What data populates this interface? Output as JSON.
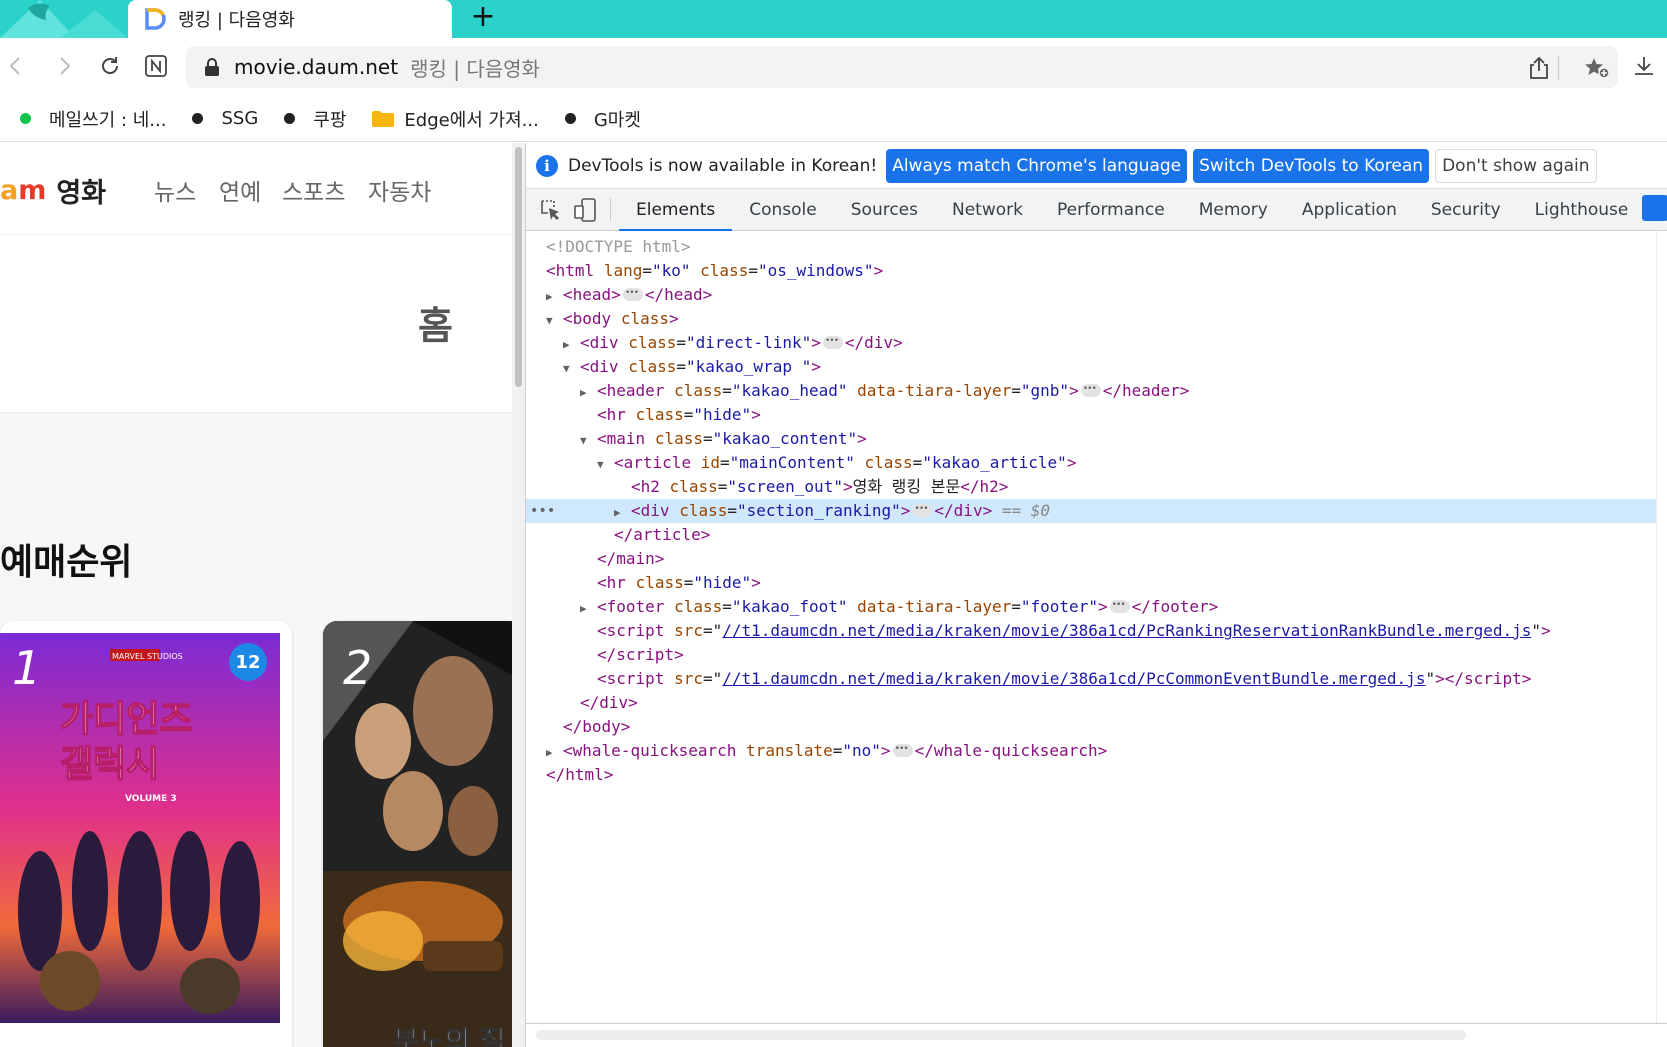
{
  "browser": {
    "tab_title": "랭킹 | 다음영화",
    "new_tab_label": "+",
    "url_host": "movie.daum.net",
    "url_page_title": "랭킹 | 다음영화",
    "accent_color": "#2ad2c9"
  },
  "bookmarks": [
    {
      "label": "메일쓰기 : 네...",
      "type": "dot-green"
    },
    {
      "label": "SSG",
      "type": "dot"
    },
    {
      "label": "쿠팡",
      "type": "dot"
    },
    {
      "label": "Edge에서 가져...",
      "type": "folder"
    },
    {
      "label": "G마켓",
      "type": "dot"
    }
  ],
  "page": {
    "logo_daum_prefix": "a",
    "logo_daum_suffix": "m",
    "logo_text": "영화",
    "gnb": [
      "뉴스",
      "연예",
      "스포츠",
      "자동차"
    ],
    "home_label": "홈",
    "rank_title": "예매순위",
    "posters": [
      {
        "rank": "1",
        "age": "12",
        "title_art": "가디언즈 오브 갤럭시",
        "subtitle": "VOLUME 3"
      },
      {
        "rank": "2",
        "title_art": "분노의 질주"
      }
    ]
  },
  "devtools": {
    "info_text": "DevTools is now available in Korean!",
    "btn_match": "Always match Chrome's language",
    "btn_switch": "Switch DevTools to Korean",
    "btn_dismiss": "Don't show again",
    "tabs": [
      "Elements",
      "Console",
      "Sources",
      "Network",
      "Performance",
      "Memory",
      "Application",
      "Security",
      "Lighthouse"
    ],
    "active_tab": "Elements",
    "dom": {
      "doctype": "<!DOCTYPE html>",
      "html_open": "html",
      "lang_attr": "lang",
      "lang_val": "\"ko\"",
      "class_attr": "class",
      "html_class_val": "\"os_windows\"",
      "head": "head",
      "body": "body",
      "div": "div",
      "direct_link_val": "\"direct-link\"",
      "kakao_wrap_val": "\"kakao_wrap \"",
      "header": "header",
      "kakao_head_val": "\"kakao_head\"",
      "tiara_attr": "data-tiara-layer",
      "gnb_val": "\"gnb\"",
      "hr": "hr",
      "hide_val": "\"hide\"",
      "main": "main",
      "kakao_content_val": "\"kakao_content\"",
      "article": "article",
      "id_attr": "id",
      "main_content_val": "\"mainContent\"",
      "kakao_article_val": "\"kakao_article\"",
      "h2": "h2",
      "screen_out_val": "\"screen_out\"",
      "h2_text": "영화 랭킹 본문",
      "section_ranking_val": "\"section_ranking\"",
      "eq_marker": "== $0",
      "footer": "footer",
      "kakao_foot_val": "\"kakao_foot\"",
      "footer_val": "\"footer\"",
      "script": "script",
      "src_attr": "src",
      "script1_src": "//t1.daumcdn.net/media/kraken/movie/386a1cd/PcRankingReservationRankBundle.merged.js",
      "script2_src": "//t1.daumcdn.net/media/kraken/movie/386a1cd/PcCommonEventBundle.merged.js",
      "whale": "whale-quicksearch",
      "translate_attr": "translate",
      "translate_val": "\"no\"",
      "gutter": "•••"
    }
  }
}
